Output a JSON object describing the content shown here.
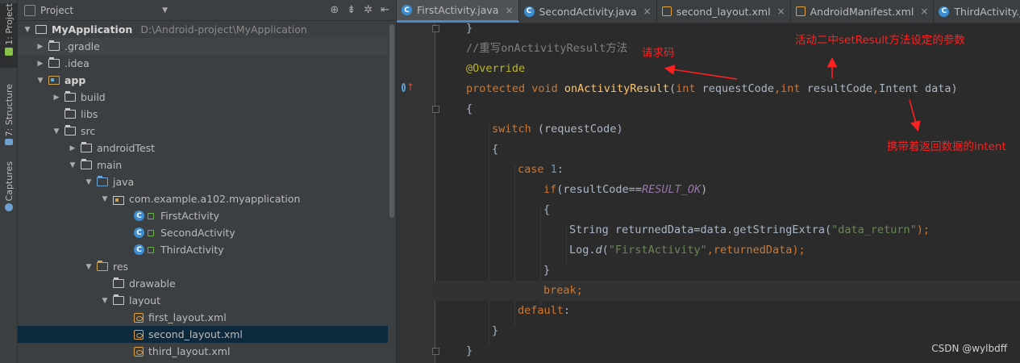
{
  "sidebar": {
    "tabs": [
      {
        "label": "1: Project"
      },
      {
        "label": "7: Structure"
      },
      {
        "label": "Captures"
      }
    ]
  },
  "project_panel": {
    "title": "Project",
    "tree": [
      {
        "label": "MyApplication",
        "path": "D:\\Android-project\\MyApplication"
      },
      {
        "label": ".gradle"
      },
      {
        "label": ".idea"
      },
      {
        "label": "app"
      },
      {
        "label": "build"
      },
      {
        "label": "libs"
      },
      {
        "label": "src"
      },
      {
        "label": "androidTest"
      },
      {
        "label": "main"
      },
      {
        "label": "java"
      },
      {
        "label": "com.example.a102.myapplication"
      },
      {
        "label": "FirstActivity"
      },
      {
        "label": "SecondActivity"
      },
      {
        "label": "ThirdActivity"
      },
      {
        "label": "res"
      },
      {
        "label": "drawable"
      },
      {
        "label": "layout"
      },
      {
        "label": "first_layout.xml"
      },
      {
        "label": "second_layout.xml"
      },
      {
        "label": "third_layout.xml"
      }
    ]
  },
  "editor": {
    "tabs": [
      {
        "label": "FirstActivity.java"
      },
      {
        "label": "SecondActivity.java"
      },
      {
        "label": "second_layout.xml"
      },
      {
        "label": "AndroidManifest.xml"
      },
      {
        "label": "ThirdActivity.java"
      }
    ],
    "code": {
      "l0": "}",
      "l1_comment": "//重写onActivityResult方法",
      "l2_annotation": "@Override",
      "l3_kw": "protected void ",
      "l3_fn": "onActivityResult",
      "l3_open": "(",
      "l3_int1": "int ",
      "l3_p1": "requestCode",
      "l3_comma1": ",",
      "l3_int2": "int ",
      "l3_p2": "resultCode",
      "l3_comma2": ",",
      "l3_p3": "Intent data)",
      "l4": "{",
      "l5_kw": "switch",
      "l5_rest": " (requestCode)",
      "l6": "{",
      "l7_kw": "case ",
      "l7_num": "1",
      "l7_colon": ":",
      "l8_kw": "if",
      "l8_a": "(resultCode==",
      "l8_const": "RESULT_OK",
      "l8_b": ")",
      "l9": "{",
      "l10_a": "String returnedData=data.getStringExtra(",
      "l10_str": "\"data_return\"",
      "l10_b": ");",
      "l11_a": "Log.",
      "l11_ital": "d",
      "l11_b": "(",
      "l11_str": "\"FirstActivity\"",
      "l11_c": ",returnedData);",
      "l12": "}",
      "l13_kw": "break",
      "l13_semi": ";",
      "l14_kw": "default",
      "l14_colon": ":",
      "l15": "}",
      "l16": "}"
    }
  },
  "annotations": {
    "request_code": "请求码",
    "set_result_param": "活动二中setResult方法设定的参数",
    "intent_data": "携带着返回数据的intent"
  },
  "watermark": "CSDN @wylbdff",
  "colors": {
    "annotation": "#ff2020",
    "keyword": "#cc7832",
    "function": "#ffc66d",
    "string": "#6a8759"
  }
}
